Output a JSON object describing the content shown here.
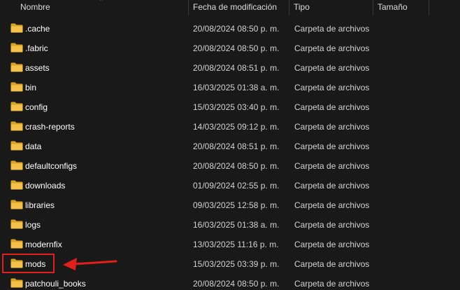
{
  "columns": {
    "name": "Nombre",
    "date": "Fecha de modificación",
    "type": "Tipo",
    "size": "Tamaño"
  },
  "colors": {
    "background": "#191919",
    "folder_yellow": "#f5c04a",
    "folder_dark": "#d9a21f",
    "highlight_red": "#e0201c"
  },
  "icons": {
    "row_icon": "folder-icon",
    "header_sort": "sort-up-icon"
  },
  "sort_glyph": "⌃",
  "rows": [
    {
      "name": ".cache",
      "date": "20/08/2024 08:50 p. m.",
      "type": "Carpeta de archivos"
    },
    {
      "name": ".fabric",
      "date": "20/08/2024 08:50 p. m.",
      "type": "Carpeta de archivos"
    },
    {
      "name": "assets",
      "date": "20/08/2024 08:51 p. m.",
      "type": "Carpeta de archivos"
    },
    {
      "name": "bin",
      "date": "16/03/2025 01:38 a. m.",
      "type": "Carpeta de archivos"
    },
    {
      "name": "config",
      "date": "15/03/2025 03:40 p. m.",
      "type": "Carpeta de archivos"
    },
    {
      "name": "crash-reports",
      "date": "14/03/2025 09:12 p. m.",
      "type": "Carpeta de archivos"
    },
    {
      "name": "data",
      "date": "20/08/2024 08:51 p. m.",
      "type": "Carpeta de archivos"
    },
    {
      "name": "defaultconfigs",
      "date": "20/08/2024 08:50 p. m.",
      "type": "Carpeta de archivos"
    },
    {
      "name": "downloads",
      "date": "01/09/2024 02:55 p. m.",
      "type": "Carpeta de archivos"
    },
    {
      "name": "libraries",
      "date": "09/03/2025 12:58 p. m.",
      "type": "Carpeta de archivos"
    },
    {
      "name": "logs",
      "date": "16/03/2025 01:38 a. m.",
      "type": "Carpeta de archivos"
    },
    {
      "name": "modernfix",
      "date": "13/03/2025 11:16 p. m.",
      "type": "Carpeta de archivos"
    },
    {
      "name": "mods",
      "date": "15/03/2025 03:39 p. m.",
      "type": "Carpeta de archivos"
    },
    {
      "name": "patchouli_books",
      "date": "20/08/2024 08:50 p. m.",
      "type": "Carpeta de archivos"
    }
  ]
}
